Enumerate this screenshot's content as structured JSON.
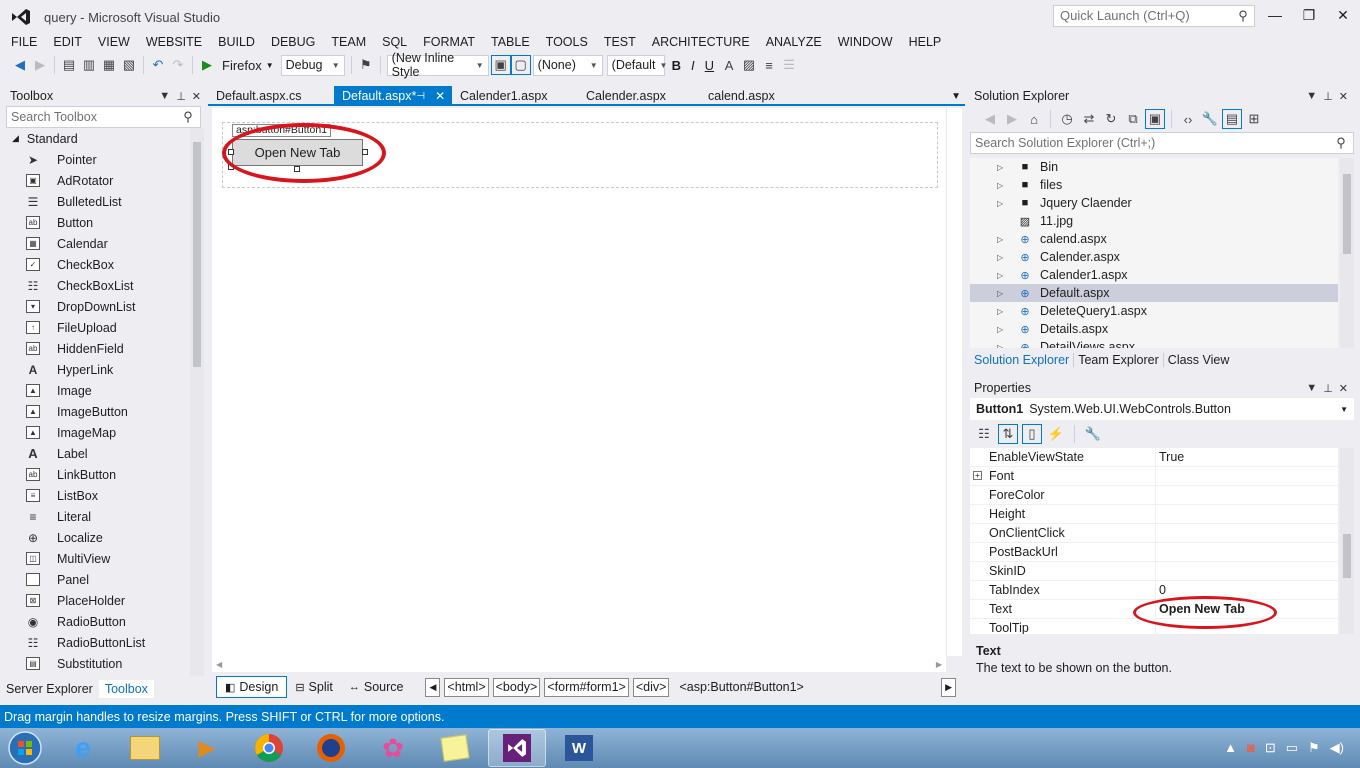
{
  "window": {
    "title": "query - Microsoft Visual Studio",
    "quick_launch_placeholder": "Quick Launch (Ctrl+Q)"
  },
  "menu": [
    "FILE",
    "EDIT",
    "VIEW",
    "WEBSITE",
    "BUILD",
    "DEBUG",
    "TEAM",
    "SQL",
    "FORMAT",
    "TABLE",
    "TOOLS",
    "TEST",
    "ARCHITECTURE",
    "ANALYZE",
    "WINDOW",
    "HELP"
  ],
  "toolbar": {
    "browser": "Firefox",
    "config": "Debug",
    "style_dd": "(New Inline Style",
    "target_dd": "(None)",
    "font_dd": "(Default",
    "bold": "B",
    "italic": "I",
    "underline": "U"
  },
  "toolbox": {
    "title": "Toolbox",
    "search_placeholder": "Search Toolbox",
    "group": "Standard",
    "items": [
      "Pointer",
      "AdRotator",
      "BulletedList",
      "Button",
      "Calendar",
      "CheckBox",
      "CheckBoxList",
      "DropDownList",
      "FileUpload",
      "HiddenField",
      "HyperLink",
      "Image",
      "ImageButton",
      "ImageMap",
      "Label",
      "LinkButton",
      "ListBox",
      "Literal",
      "Localize",
      "MultiView",
      "Panel",
      "PlaceHolder",
      "RadioButton",
      "RadioButtonList",
      "Substitution"
    ],
    "bottom_tabs": [
      "Server Explorer",
      "Toolbox"
    ]
  },
  "doc_tabs": [
    "Default.aspx.cs",
    "Default.aspx*",
    "Calender1.aspx",
    "Calender.aspx",
    "calend.aspx"
  ],
  "designer": {
    "tag_label": "asp:button#Button1",
    "button_text": "Open New Tab"
  },
  "view_bar": {
    "design": "Design",
    "split": "Split",
    "source": "Source",
    "crumbs": [
      "<html>",
      "<body>",
      "<form#form1>",
      "<div>"
    ],
    "current": "<asp:Button#Button1>"
  },
  "solution_explorer": {
    "title": "Solution Explorer",
    "search_placeholder": "Search Solution Explorer (Ctrl+;)",
    "items": [
      {
        "name": "Bin",
        "type": "folder",
        "expand": true
      },
      {
        "name": "files",
        "type": "folder",
        "expand": true
      },
      {
        "name": "Jquery Claender",
        "type": "folder",
        "expand": true
      },
      {
        "name": "11.jpg",
        "type": "image",
        "expand": false
      },
      {
        "name": "calend.aspx",
        "type": "page",
        "expand": true
      },
      {
        "name": "Calender.aspx",
        "type": "page",
        "expand": true
      },
      {
        "name": "Calender1.aspx",
        "type": "page",
        "expand": true
      },
      {
        "name": "Default.aspx",
        "type": "page",
        "expand": true,
        "selected": true
      },
      {
        "name": "DeleteQuery1.aspx",
        "type": "page",
        "expand": true
      },
      {
        "name": "Details.aspx",
        "type": "page",
        "expand": true
      },
      {
        "name": "DetailViews.aspx",
        "type": "page",
        "expand": true
      }
    ],
    "tabs": [
      "Solution Explorer",
      "Team Explorer",
      "Class View"
    ]
  },
  "properties": {
    "title": "Properties",
    "object": "Button1",
    "object_type": "System.Web.UI.WebControls.Button",
    "rows": [
      {
        "name": "EnableViewState",
        "value": "True"
      },
      {
        "name": "Font",
        "value": "",
        "expandable": true
      },
      {
        "name": "ForeColor",
        "value": ""
      },
      {
        "name": "Height",
        "value": ""
      },
      {
        "name": "OnClientClick",
        "value": ""
      },
      {
        "name": "PostBackUrl",
        "value": ""
      },
      {
        "name": "SkinID",
        "value": ""
      },
      {
        "name": "TabIndex",
        "value": "0"
      },
      {
        "name": "Text",
        "value": "Open New Tab",
        "bold": true
      },
      {
        "name": "ToolTip",
        "value": ""
      }
    ],
    "desc_title": "Text",
    "desc_text": "The text to be shown on the button."
  },
  "status": "Drag margin handles to resize margins. Press SHIFT or CTRL for more options.",
  "colors": {
    "accent": "#007acc",
    "highlight_ellipse": "#d8141c"
  }
}
